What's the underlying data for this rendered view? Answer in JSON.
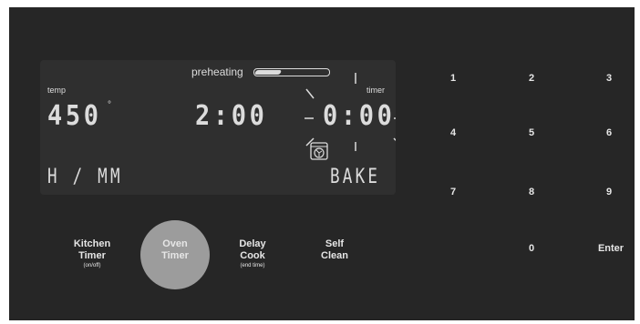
{
  "display": {
    "preheat_label": "preheating",
    "temp_label": "temp",
    "timer_label": "timer",
    "temp_value": "450",
    "degree_symbol": "°",
    "cook_time": "2:00",
    "timer_value": "0:00",
    "mode_left": "H / MM",
    "mode_right": "BAKE",
    "preheat_progress": 0.35,
    "cook_icon": "convection-fan-icon"
  },
  "keys": {
    "kitchen_timer": {
      "line1": "Kitchen",
      "line2": "Timer",
      "sub": "(on/off)"
    },
    "oven_timer": {
      "line1": "Oven",
      "line2": "Timer"
    },
    "delay_cook": {
      "line1": "Delay",
      "line2": "Cook",
      "sub": "(end time)"
    },
    "self_clean": {
      "line1": "Self",
      "line2": "Clean"
    }
  },
  "keypad": [
    "1",
    "2",
    "3",
    "4",
    "5",
    "6",
    "7",
    "8",
    "9",
    "0",
    "Enter"
  ],
  "colors": {
    "panel": "#262626",
    "display": "#2f2f2f",
    "segment": "#dcdcdc",
    "selected_button": "#9c9c9c"
  }
}
